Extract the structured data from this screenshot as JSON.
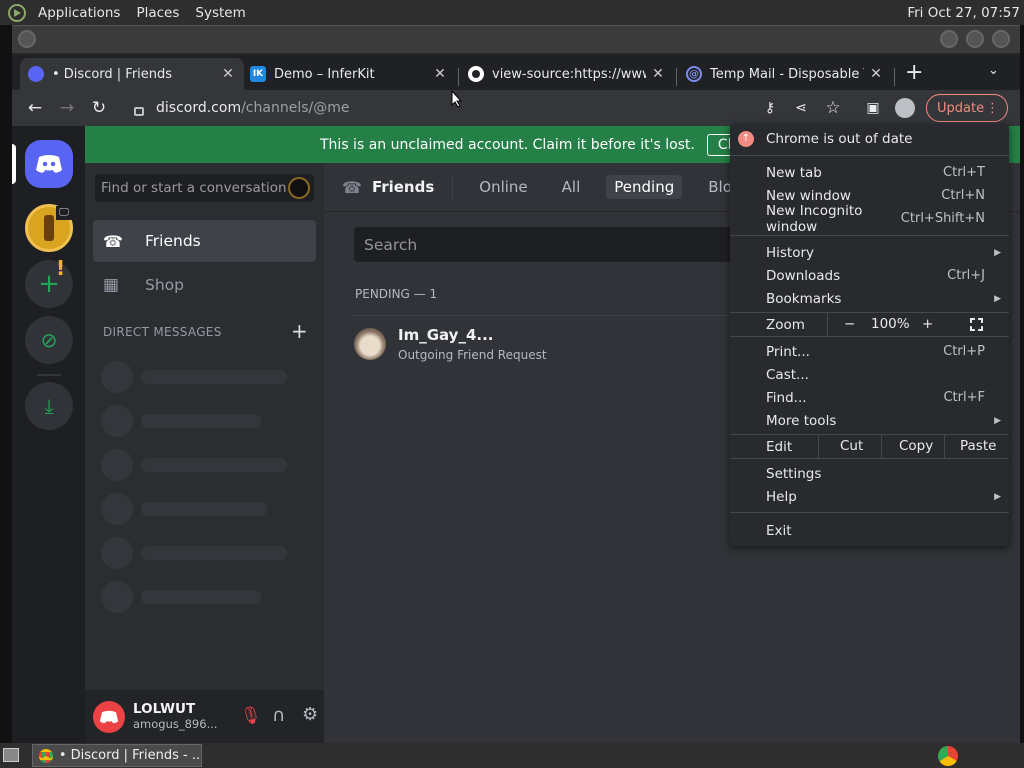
{
  "topbar": {
    "menus": [
      "Applications",
      "Places",
      "System"
    ],
    "clock": "Fri Oct 27, 07:57"
  },
  "tabs": [
    {
      "title": "• Discord | Friends",
      "favicon": "discord-icon",
      "color": "#5865f2"
    },
    {
      "title": "Demo – InferKit",
      "favicon": "inferkit-icon",
      "color": "#1e88e5",
      "fav_text": "IK"
    },
    {
      "title": "view-source:https://www.a",
      "favicon": "github-icon",
      "color": "#ffffff"
    },
    {
      "title": "Temp Mail - Disposable Te",
      "favicon": "at-sign-icon",
      "color": "#5b6ce0"
    }
  ],
  "omnibox": {
    "host": "discord.com",
    "path": "/channels/@me"
  },
  "toolbar": {
    "update_label": "Update"
  },
  "discord": {
    "claim_text": "This is an unclaimed account. Claim it before it's lost.",
    "claim_button": "Claim Account",
    "search_placeholder": "Find or start a conversation",
    "sidebar": {
      "friends_label": "Friends",
      "shop_label": "Shop",
      "dm_header": "DIRECT MESSAGES",
      "dm_add": "+"
    },
    "friends_header": {
      "title": "Friends",
      "tabs": [
        "Online",
        "All",
        "Pending",
        "Blocked"
      ],
      "active_tab": "Pending"
    },
    "friends_search_placeholder": "Search",
    "pending_header": "PENDING — 1",
    "pending": [
      {
        "name": "Im_Gay_4...",
        "status": "Outgoing Friend Request"
      }
    ],
    "user": {
      "name": "LOLWUT",
      "tag": "amogus_896..."
    },
    "colors": {
      "brand": "#5865f2",
      "green": "#248046",
      "bg": "#313338"
    }
  },
  "chrome_menu": {
    "alert": "Chrome is out of date",
    "group1": [
      {
        "label": "New tab",
        "shortcut": "Ctrl+T"
      },
      {
        "label": "New window",
        "shortcut": "Ctrl+N"
      },
      {
        "label": "New Incognito window",
        "shortcut": "Ctrl+Shift+N"
      }
    ],
    "group2": [
      {
        "label": "History",
        "submenu": true
      },
      {
        "label": "Downloads",
        "shortcut": "Ctrl+J"
      },
      {
        "label": "Bookmarks",
        "submenu": true
      }
    ],
    "zoom": {
      "label": "Zoom",
      "minus": "−",
      "value": "100%",
      "plus": "+"
    },
    "group3": [
      {
        "label": "Print...",
        "shortcut": "Ctrl+P"
      },
      {
        "label": "Cast...",
        "shortcut": ""
      },
      {
        "label": "Find...",
        "shortcut": "Ctrl+F"
      },
      {
        "label": "More tools",
        "submenu": true
      }
    ],
    "edit": {
      "label": "Edit",
      "cut": "Cut",
      "copy": "Copy",
      "paste": "Paste"
    },
    "group4": [
      {
        "label": "Settings",
        "shortcut": ""
      },
      {
        "label": "Help",
        "submenu": true
      }
    ],
    "exit": "Exit"
  },
  "taskbar": {
    "window_title": "• Discord | Friends - ..."
  }
}
